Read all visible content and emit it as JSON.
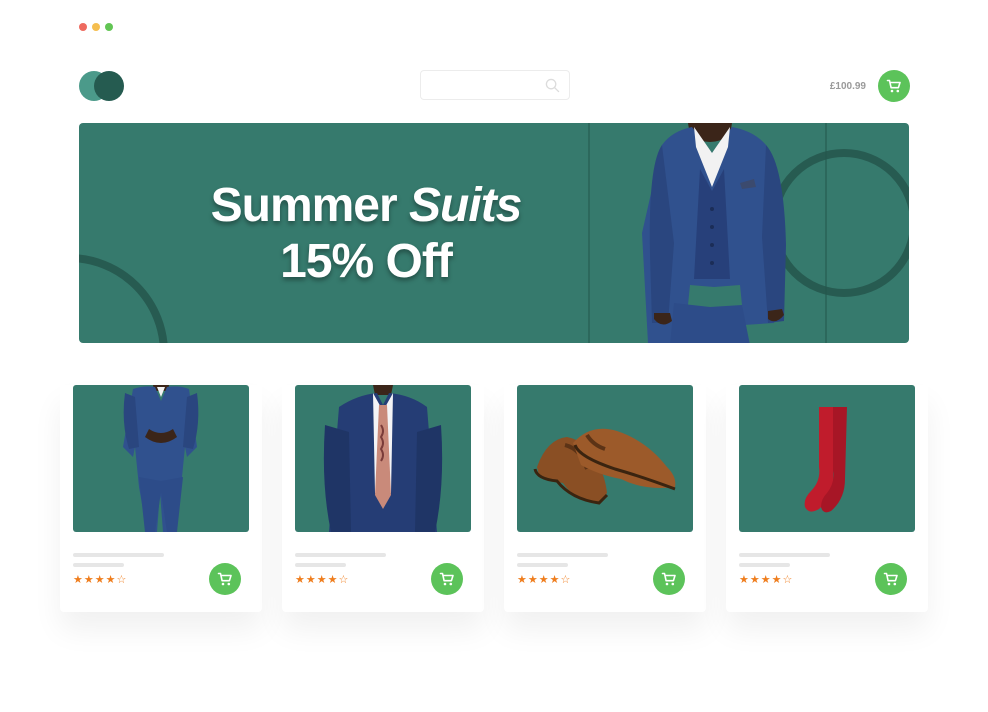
{
  "window": {
    "dot_colors": [
      "#ee6a5f",
      "#f5be4f",
      "#62c554"
    ]
  },
  "brand": {
    "logo_colors": [
      "#4b9a8a",
      "#255b50"
    ]
  },
  "search": {
    "placeholder": "",
    "icon": "search-icon"
  },
  "cart": {
    "total": "£100.99",
    "icon": "cart-icon"
  },
  "colors": {
    "accent": "#5cc35a",
    "banner": "#367a6d",
    "star": "#ef7d1d"
  },
  "banner": {
    "line1": "Summer ",
    "line1_italic": "Suits",
    "line2": "15% Off"
  },
  "products": [
    {
      "image": "suit-model-image",
      "rating": 4,
      "stars": "★★★★☆"
    },
    {
      "image": "blazer-tie-image",
      "rating": 4,
      "stars": "★★★★☆"
    },
    {
      "image": "brown-shoes-image",
      "rating": 4,
      "stars": "★★★★☆"
    },
    {
      "image": "red-socks-image",
      "rating": 4,
      "stars": "★★★★☆"
    }
  ]
}
